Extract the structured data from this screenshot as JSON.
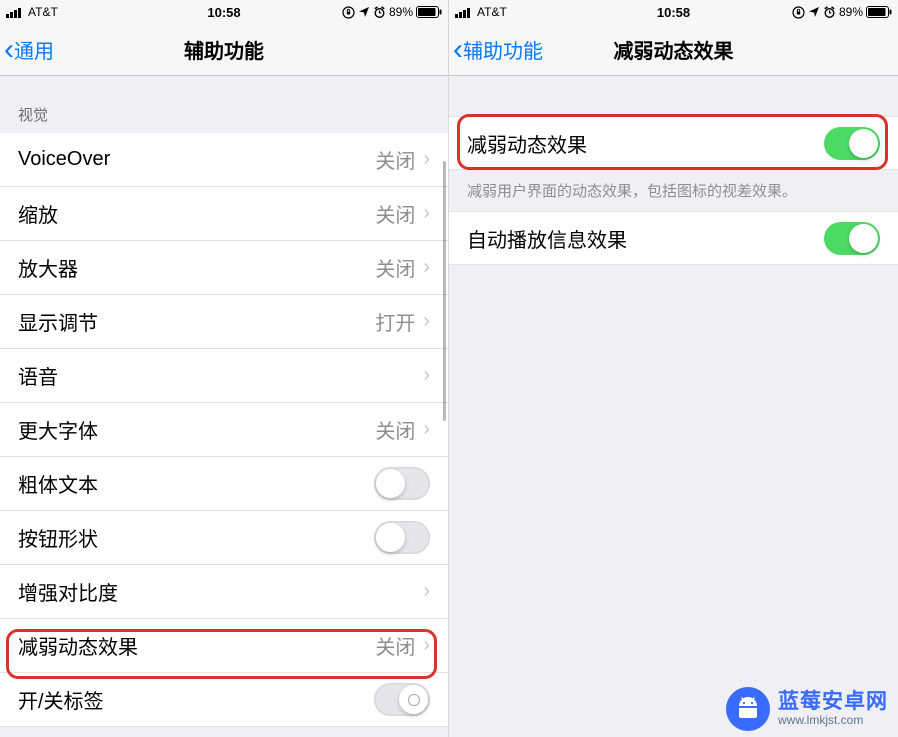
{
  "status": {
    "carrier": "AT&T",
    "time": "10:58",
    "battery": "89%"
  },
  "left": {
    "back": "通用",
    "title": "辅助功能",
    "section_vision": "视觉",
    "rows": {
      "voiceover": {
        "label": "VoiceOver",
        "value": "关闭"
      },
      "zoom": {
        "label": "缩放",
        "value": "关闭"
      },
      "magnifier": {
        "label": "放大器",
        "value": "关闭"
      },
      "display": {
        "label": "显示调节",
        "value": "打开"
      },
      "speech": {
        "label": "语音",
        "value": ""
      },
      "larger_text": {
        "label": "更大字体",
        "value": "关闭"
      },
      "bold_text": {
        "label": "粗体文本"
      },
      "button_shapes": {
        "label": "按钮形状"
      },
      "contrast": {
        "label": "增强对比度",
        "value": ""
      },
      "reduce_motion": {
        "label": "减弱动态效果",
        "value": "关闭"
      },
      "onoff_labels": {
        "label": "开/关标签"
      }
    }
  },
  "right": {
    "back": "辅助功能",
    "title": "减弱动态效果",
    "rows": {
      "reduce_motion": {
        "label": "减弱动态效果",
        "on": true
      },
      "footer": "减弱用户界面的动态效果，包括图标的视差效果。",
      "autoplay": {
        "label": "自动播放信息效果",
        "on": true
      }
    }
  },
  "watermark": {
    "title": "蓝莓安卓网",
    "url": "www.lmkjst.com"
  }
}
